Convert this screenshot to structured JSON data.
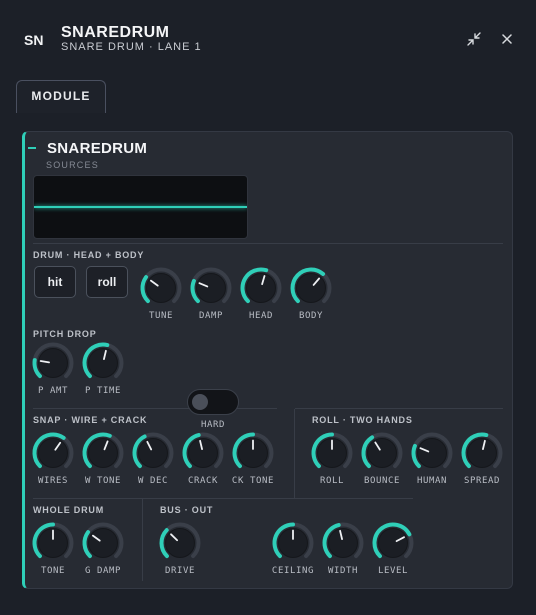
{
  "header": {
    "badge": "SN",
    "title": "SNAREDRUM",
    "subtitle": "SNARE DRUM · LANE 1",
    "collapse_icon": "collapse-arrows-icon",
    "close_icon": "close-icon"
  },
  "tabs": [
    {
      "label": "MODULE",
      "active": true
    }
  ],
  "module": {
    "name": "SNAREDRUM",
    "sources_label": "SOURCES",
    "accent_color": "#2fcfb8",
    "sections": {
      "drum": {
        "label": "DRUM · HEAD + BODY",
        "buttons": [
          "hit",
          "roll"
        ]
      },
      "pitch": {
        "label": "PITCH DROP"
      },
      "snap": {
        "label": "SNAP · WIRE + CRACK"
      },
      "roll": {
        "label": "ROLL · TWO HANDS"
      },
      "whole": {
        "label": "WHOLE DRUM"
      },
      "bus": {
        "label": "BUS · OUT"
      }
    },
    "knobs": [
      {
        "id": "tune",
        "label": "TUNE",
        "value": 0.3
      },
      {
        "id": "damp",
        "label": "DAMP",
        "value": 0.25
      },
      {
        "id": "head",
        "label": "HEAD",
        "value": 0.56
      },
      {
        "id": "body",
        "label": "BODY",
        "value": 0.65
      },
      {
        "id": "p_amt",
        "label": "P AMT",
        "value": 0.2
      },
      {
        "id": "p_time",
        "label": "P TIME",
        "value": 0.55
      },
      {
        "id": "wires",
        "label": "WIRES",
        "value": 0.63
      },
      {
        "id": "w_tone",
        "label": "W TONE",
        "value": 0.58
      },
      {
        "id": "w_dec",
        "label": "W DEC",
        "value": 0.4
      },
      {
        "id": "crack",
        "label": "CRACK",
        "value": 0.45
      },
      {
        "id": "ck_tone",
        "label": "CK TONE",
        "value": 0.5
      },
      {
        "id": "roll",
        "label": "ROLL",
        "value": 0.5
      },
      {
        "id": "bounce",
        "label": "BOUNCE",
        "value": 0.38
      },
      {
        "id": "human",
        "label": "HUMAN",
        "value": 0.25
      },
      {
        "id": "spread",
        "label": "SPREAD",
        "value": 0.55
      },
      {
        "id": "tone",
        "label": "TONE",
        "value": 0.5
      },
      {
        "id": "g_damp",
        "label": "G DAMP",
        "value": 0.3
      },
      {
        "id": "drive",
        "label": "DRIVE",
        "value": 0.33
      },
      {
        "id": "ceiling",
        "label": "CEILING",
        "value": 0.5
      },
      {
        "id": "width",
        "label": "WIDTH",
        "value": 0.45
      },
      {
        "id": "level",
        "label": "LEVEL",
        "value": 0.73
      }
    ],
    "hard_toggle": {
      "label": "HARD",
      "on": false
    }
  }
}
